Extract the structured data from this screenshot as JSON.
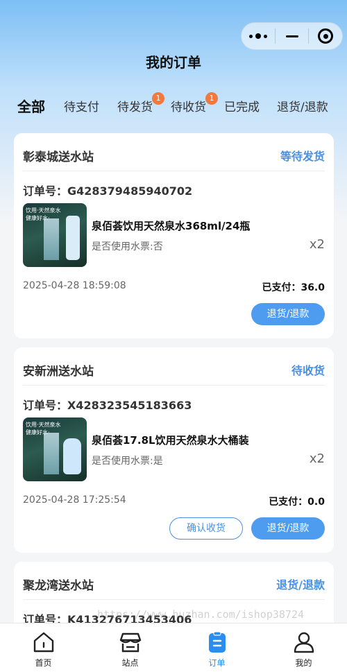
{
  "header": {
    "title": "我的订单"
  },
  "capsule": {
    "more_icon": "more-dots-icon",
    "minimize_icon": "minimize-icon",
    "close_icon": "target-close-icon"
  },
  "tabs": [
    {
      "label": "全部",
      "active": true
    },
    {
      "label": "待支付"
    },
    {
      "label": "待发货",
      "badge": "1"
    },
    {
      "label": "待收货",
      "badge": "1"
    },
    {
      "label": "已完成"
    },
    {
      "label": "退货/退款"
    }
  ],
  "orders": [
    {
      "store": "彰泰城送水站",
      "status": "等待发货",
      "order_no": "订单号：G428379485940702",
      "image_text": [
        "饮用·天然泉水",
        "健康好水·"
      ],
      "product": "泉佰荟饮用天然泉水368ml/24瓶",
      "ticket": "是否使用水票:否",
      "qty": "x2",
      "time": "2025-04-28 18:59:08",
      "paid": "已支付：36.0",
      "buttons": [
        "退货/退款"
      ]
    },
    {
      "store": "安新洲送水站",
      "status": "待收货",
      "order_no": "订单号：X428323545183663",
      "image_text": [
        "饮用·天然泉水",
        "健康好水·"
      ],
      "product": "泉佰荟17.8L饮用天然泉水大桶装",
      "ticket": "是否使用水票:是",
      "qty": "x2",
      "time": "2025-04-28 17:25:54",
      "paid": "已支付：0.0",
      "buttons": [
        "确认收货",
        "退货/退款"
      ]
    },
    {
      "store": "聚龙湾送水站",
      "status": "退货/退款",
      "order_no": "订单号：K413276713453406"
    }
  ],
  "watermark": "https://www.huzhan.com/ishop38724",
  "tabbar": [
    {
      "label": "首页",
      "icon": "home-icon"
    },
    {
      "label": "站点",
      "icon": "store-icon"
    },
    {
      "label": "订单",
      "icon": "order-icon",
      "active": true
    },
    {
      "label": "我的",
      "icon": "user-icon"
    }
  ],
  "colors": {
    "accent": "#4a90e2",
    "badge": "#f07a3d",
    "primary_button": "#4d9cf0"
  }
}
